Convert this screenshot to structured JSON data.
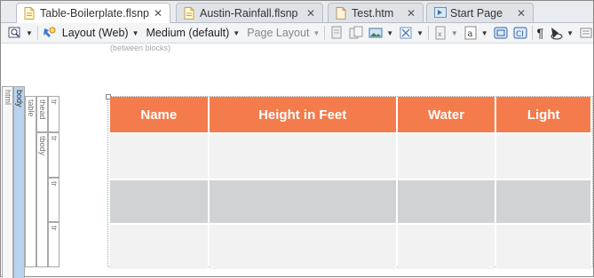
{
  "tabs": [
    {
      "label": "Table-Boilerplate.flsnp",
      "active": true,
      "icon": "snippet-file-icon"
    },
    {
      "label": "Austin-Rainfall.flsnp",
      "active": false,
      "icon": "snippet-file-icon"
    },
    {
      "label": "Test.htm",
      "active": false,
      "icon": "topic-file-icon"
    },
    {
      "label": "Start Page",
      "active": false,
      "icon": "start-page-icon"
    }
  ],
  "tab_close_glyph": "✕",
  "toolbar": {
    "layout": "Layout (Web)",
    "medium": "Medium (default)",
    "page_layout": "Page Layout",
    "pilcrow": "¶"
  },
  "hint": "(between blocks)",
  "structure": {
    "html": "html",
    "body": "body",
    "table": "table",
    "thead": "thead",
    "tbody": "tbody",
    "tr": "tr"
  },
  "table": {
    "headers": [
      "Name",
      "Height in Feet",
      "Water",
      "Light"
    ]
  },
  "colors": {
    "header_bg": "#f47b4c",
    "row_light": "#f1f2f1",
    "row_dark": "#d0d3d6",
    "body_bar": "#b8d4f0"
  }
}
